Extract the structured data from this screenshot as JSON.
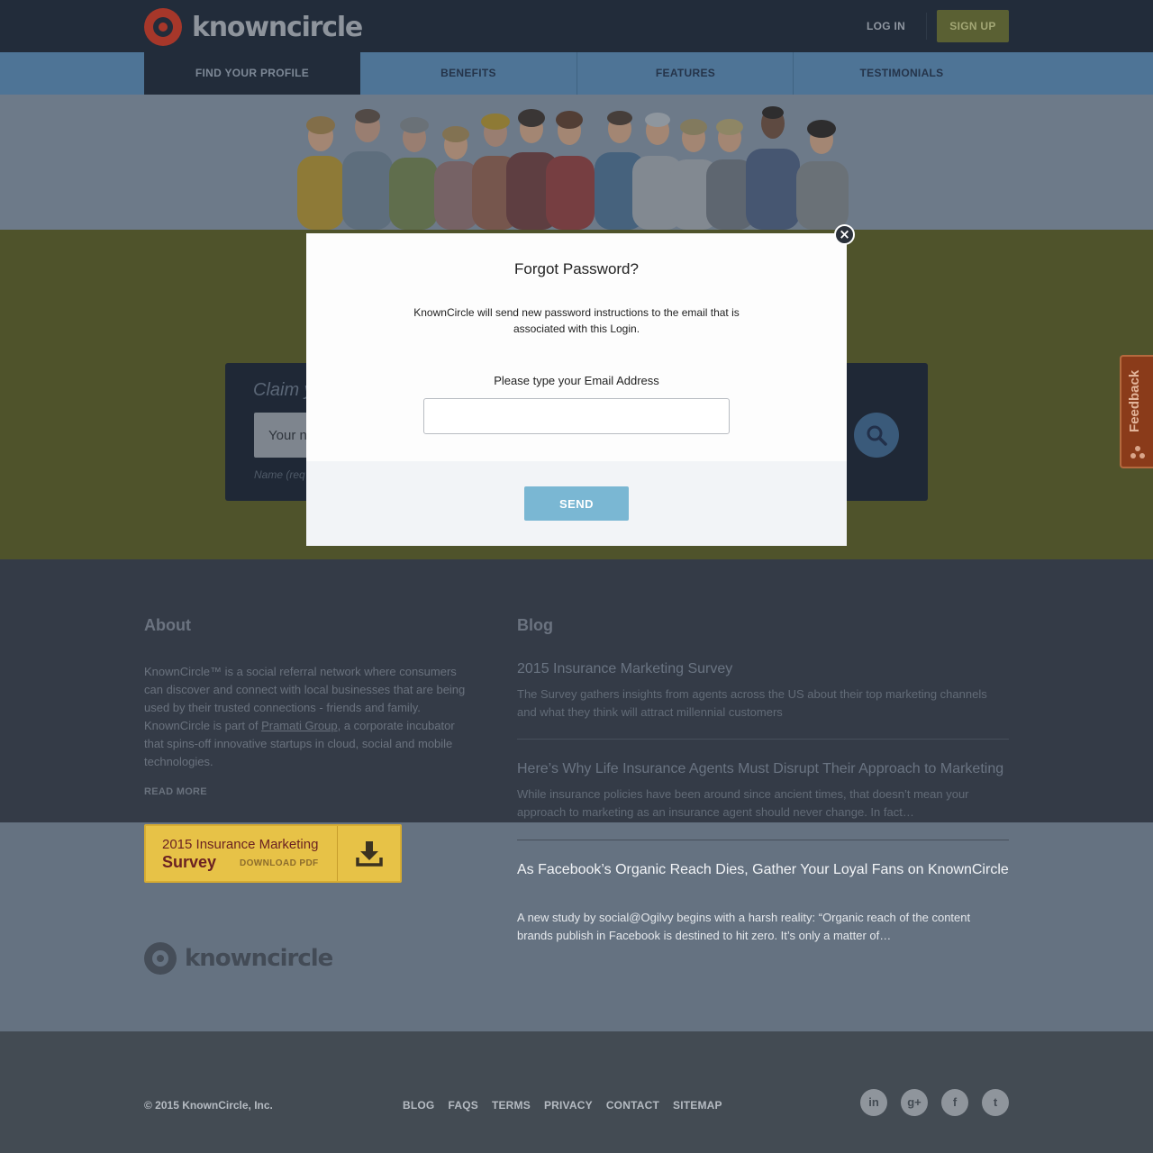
{
  "header": {
    "logo_text": "knowncircle",
    "login_label": "LOG IN",
    "signup_label": "SIGN UP"
  },
  "nav": {
    "items": [
      {
        "label": "FIND YOUR PROFILE",
        "active": true
      },
      {
        "label": "BENEFITS"
      },
      {
        "label": "FEATURES"
      },
      {
        "label": "TESTIMONIALS"
      }
    ]
  },
  "claim": {
    "title_partial": "Claim y",
    "input_partial": "Your n",
    "hint_partial": "Name (req"
  },
  "feedback": {
    "label": "Feedback"
  },
  "modal": {
    "title": "Forgot Password?",
    "description": "KnownCircle will send new password instructions to the email that is associated with this Login.",
    "email_label": "Please type your Email Address",
    "email_value": "",
    "send_label": "SEND",
    "close_glyph": "×"
  },
  "about": {
    "heading": "About",
    "text_before": "KnownCircle™ is a social referral network where consumers can discover and connect with local businesses that are being used by their trusted connections - friends and family. KnownCircle is part of ",
    "link": "Pramati Group",
    "text_after": ", a corporate incubator that spins-off innovative startups in cloud, social and mobile technologies.",
    "read_more": "READ MORE"
  },
  "survey": {
    "line1": "2015 Insurance Marketing",
    "line2": "Survey",
    "line3": "DOWNLOAD PDF"
  },
  "footer_logo_text": "knowncircle",
  "blog": {
    "heading": "Blog",
    "posts": [
      {
        "title": "2015 Insurance Marketing Survey",
        "excerpt": "The Survey gathers insights from agents across the US about their top marketing channels and what they think will attract millennial customers"
      },
      {
        "title": "Here’s Why Life Insurance Agents Must Disrupt Their Approach to Marketing",
        "excerpt": "While insurance policies have been around since ancient times, that doesn’t mean your approach to marketing as an insurance agent should never change. In fact…"
      },
      {
        "title": "As Facebook’s Organic Reach Dies, Gather Your Loyal Fans on KnownCircle",
        "excerpt": "A new study by social@Ogilvy begins with a harsh reality: “Organic reach of the content brands publish in Facebook is destined to hit zero. It’s only a matter of…"
      }
    ]
  },
  "bottom": {
    "copyright": "© 2015 KnownCircle, Inc.",
    "links": [
      "BLOG",
      "FAQS",
      "TERMS",
      "PRIVACY",
      "CONTACT",
      "SITEMAP"
    ],
    "social": [
      {
        "icon": "linkedin-icon",
        "glyph": "in"
      },
      {
        "icon": "google-plus-icon",
        "glyph": "g+"
      },
      {
        "icon": "facebook-icon",
        "glyph": "f"
      },
      {
        "icon": "twitter-icon",
        "glyph": "t"
      }
    ]
  },
  "colors": {
    "header_bg": "#222c3a",
    "nav_bg": "#4e7496",
    "band_bg": "#4f532b",
    "send_button": "#7ab7d3",
    "survey_yellow": "#e7c247"
  }
}
